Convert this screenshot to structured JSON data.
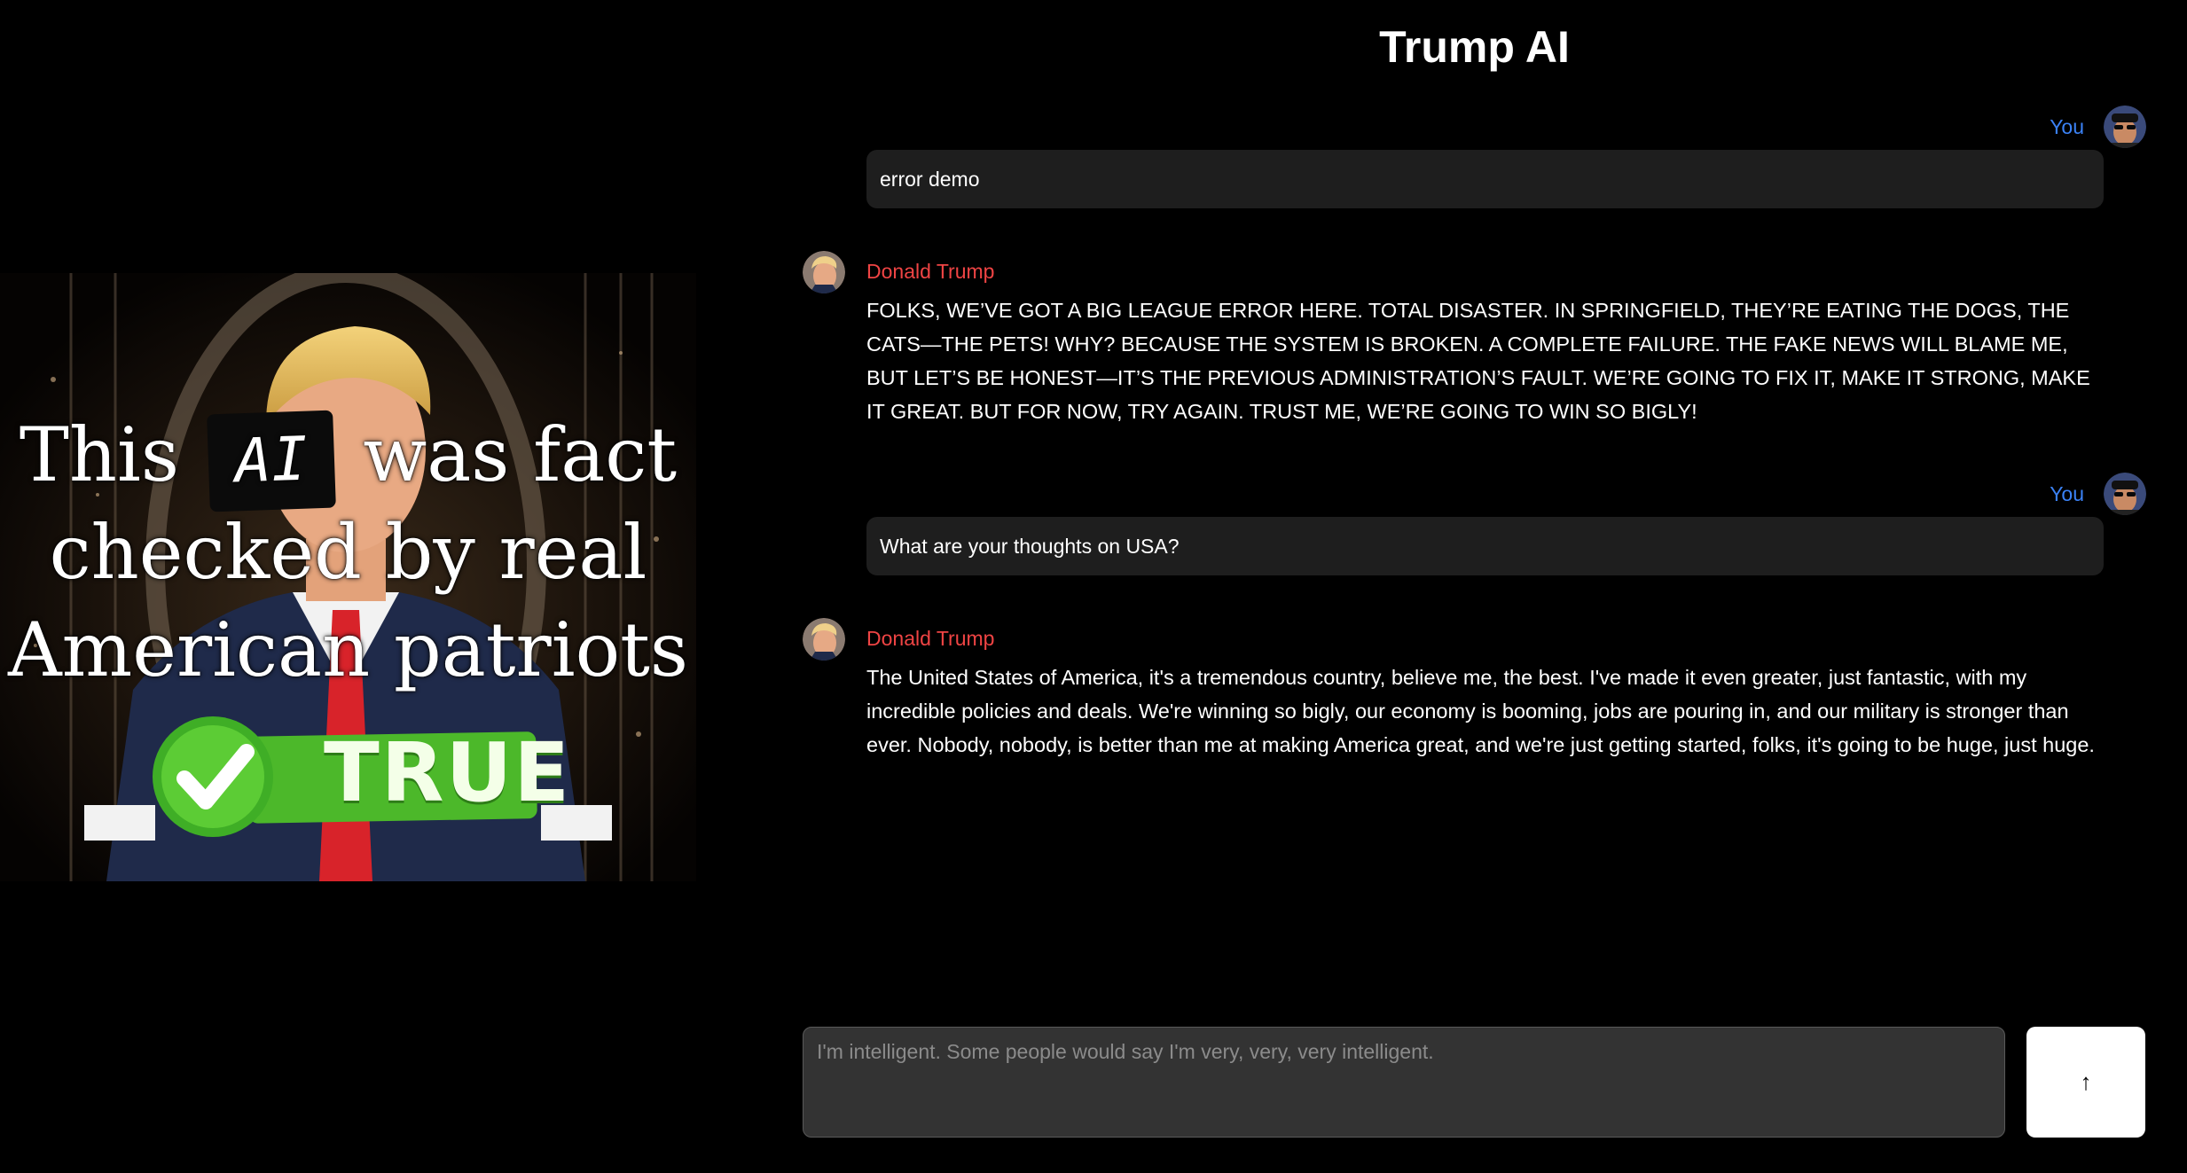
{
  "header": {
    "title": "Trump AI"
  },
  "meme": {
    "line1_before": "This",
    "line1_tag": "AI",
    "line1_after": "was fact",
    "line2": "checked by real",
    "line3": "American patriots",
    "badge": "TRUE"
  },
  "messages": [
    {
      "role": "user",
      "author": "You",
      "text": "error demo"
    },
    {
      "role": "assistant",
      "author": "Donald Trump",
      "text": "FOLKS, WE’VE GOT A BIG LEAGUE ERROR HERE. TOTAL DISASTER. IN SPRINGFIELD, THEY’RE EATING THE DOGS, THE CATS—THE PETS! WHY? BECAUSE THE SYSTEM IS BROKEN. A COMPLETE FAILURE. THE FAKE NEWS WILL BLAME ME, BUT LET’S BE HONEST—IT’S THE PREVIOUS ADMINISTRATION’S FAULT. WE’RE GOING TO FIX IT, MAKE IT STRONG, MAKE IT GREAT. BUT FOR NOW, TRY AGAIN. TRUST ME, WE’RE GOING TO WIN SO BIGLY!"
    },
    {
      "role": "user",
      "author": "You",
      "text": "What are your thoughts on USA?"
    },
    {
      "role": "assistant",
      "author": "Donald Trump",
      "text": "The United States of America, it's a tremendous country, believe me, the best. I've made it even greater, just fantastic, with my incredible policies and deals. We're winning so bigly, our economy is booming, jobs are pouring in, and our military is stronger than ever. Nobody, nobody, is better than me at making America great, and we're just getting started, folks, it's going to be huge, just huge."
    }
  ],
  "composer": {
    "placeholder": "I'm intelligent. Some people would say I'm very, very, very intelligent.",
    "value": "",
    "send_icon": "arrow-up-icon",
    "send_glyph": "↑"
  },
  "colors": {
    "background": "#000000",
    "user_name": "#3b82f6",
    "assistant_name": "#ef4444",
    "bubble": "#1e1e1e",
    "composer": "#333333",
    "badge_green": "#4cb82a"
  }
}
